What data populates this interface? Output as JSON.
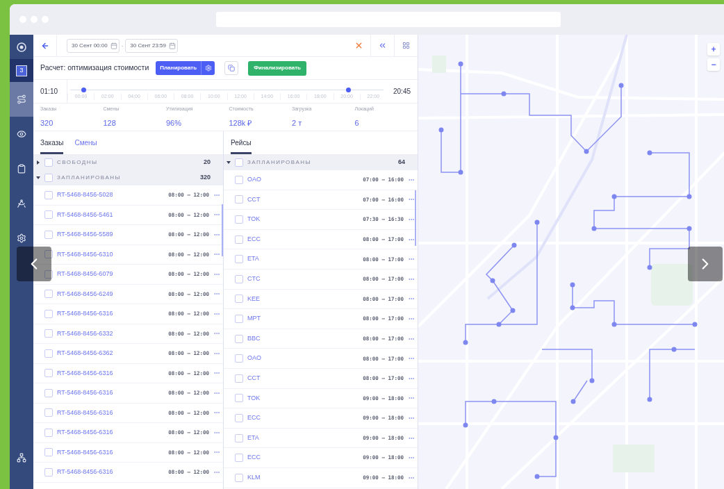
{
  "sidebar": {
    "badge": "3",
    "items": [
      {
        "selected": true
      },
      {
        "selected": false
      },
      {
        "selected": false
      },
      {
        "selected": false
      },
      {
        "selected": false
      }
    ]
  },
  "toolbar": {
    "date_from": "30 Сент 00:00",
    "separator": "-",
    "date_to": "30 Сент 23:59"
  },
  "calc": {
    "title": "Расчет: оптимизация стоимости",
    "plan_button": "Планировать",
    "finalize_button": "Финализировать"
  },
  "timeline": {
    "start": "01:10",
    "end": "20:45",
    "ticks": [
      "00:00",
      "02:00",
      "04:00",
      "06:00",
      "08:00",
      "10:00",
      "12:00",
      "14:00",
      "16:00",
      "18:00",
      "20:00",
      "22:00"
    ],
    "thumbs": [
      {
        "level": 0.05
      },
      {
        "level": 0.88
      }
    ]
  },
  "stats": [
    {
      "label": "Заказы",
      "value": "320"
    },
    {
      "label": "Смены",
      "value": "128"
    },
    {
      "label": "Утилизация",
      "value": "96%"
    },
    {
      "label": "Стоимость",
      "value": "128k ₽"
    },
    {
      "label": "Загрузка",
      "value": "2 т"
    },
    {
      "label": "Локаций",
      "value": "6"
    }
  ],
  "orders_panel": {
    "tabs": [
      {
        "label": "Заказы",
        "selected": true
      },
      {
        "label": "Смены",
        "selected": false
      }
    ],
    "groups": [
      {
        "label": "СВОБОДНЫ",
        "count": "20",
        "expanded": false,
        "checked": false
      },
      {
        "label": "ЗАПЛАНИРОВАНЫ",
        "count": "320",
        "expanded": true,
        "checked": false
      }
    ],
    "rows": [
      {
        "id": "RT-5468-8456-5028",
        "time": "08:00 — 12:00",
        "checked": false
      },
      {
        "id": "RT-5468-8456-5461",
        "time": "08:00 — 12:00",
        "checked": false
      },
      {
        "id": "RT-5468-8456-5589",
        "time": "08:00 — 12:00",
        "checked": false
      },
      {
        "id": "RT-5468-8456-6310",
        "time": "08:00 — 12:00",
        "checked": false
      },
      {
        "id": "RT-5468-8456-6079",
        "time": "08:00 — 12:00",
        "checked": false
      },
      {
        "id": "RT-5468-8456-6249",
        "time": "08:00 — 12:00",
        "checked": false
      },
      {
        "id": "RT-5468-8456-6316",
        "time": "08:00 — 12:00",
        "checked": false
      },
      {
        "id": "RT-5468-8456-6332",
        "time": "08:00 — 12:00",
        "checked": false
      },
      {
        "id": "RT-5468-8456-6362",
        "time": "08:00 — 12:00",
        "checked": false
      },
      {
        "id": "RT-5468-8456-6316",
        "time": "08:00 — 12:00",
        "checked": false
      },
      {
        "id": "RT-5468-8456-6316",
        "time": "08:00 — 12:00",
        "checked": false
      },
      {
        "id": "RT-5468-8456-6316",
        "time": "08:00 — 12:00",
        "checked": false
      },
      {
        "id": "RT-5468-8456-6316",
        "time": "08:00 — 12:00",
        "checked": false
      },
      {
        "id": "RT-5468-8456-6316",
        "time": "08:00 — 12:00",
        "checked": false
      },
      {
        "id": "RT-5468-8456-6316",
        "time": "08:00 — 12:00",
        "checked": false
      }
    ]
  },
  "trips_panel": {
    "tabs": [
      {
        "label": "Рейсы",
        "selected": true
      }
    ],
    "groups": [
      {
        "label": "ЗАПЛАНИРОВАНЫ",
        "count": "64",
        "expanded": true,
        "checked": false
      }
    ],
    "rows": [
      {
        "id": "OAO",
        "time": "07:00 — 16:00",
        "checked": false
      },
      {
        "id": "CCT",
        "time": "07:00 — 16:00",
        "checked": false
      },
      {
        "id": "TOK",
        "time": "07:30 — 16:30",
        "checked": false
      },
      {
        "id": "ECC",
        "time": "08:00 — 17:00",
        "checked": false
      },
      {
        "id": "ETA",
        "time": "08:00 — 17:00",
        "checked": false
      },
      {
        "id": "CTC",
        "time": "08:00 — 17:00",
        "checked": false
      },
      {
        "id": "KEE",
        "time": "08:00 — 17:00",
        "checked": false
      },
      {
        "id": "MPT",
        "time": "08:00 — 17:00",
        "checked": false
      },
      {
        "id": "BBC",
        "time": "08:00 — 17:00",
        "checked": false
      },
      {
        "id": "OAO",
        "time": "08:00 — 17:00",
        "checked": false
      },
      {
        "id": "CCT",
        "time": "08:00 — 17:00",
        "checked": false
      },
      {
        "id": "TOK",
        "time": "09:00 — 18:00",
        "checked": false
      },
      {
        "id": "ECC",
        "time": "09:00 — 18:00",
        "checked": false
      },
      {
        "id": "ETA",
        "time": "09:00 — 18:00",
        "checked": false
      },
      {
        "id": "ECC",
        "time": "09:00 — 18:00",
        "checked": false
      },
      {
        "id": "KLM",
        "time": "09:00 — 18:00",
        "checked": false
      }
    ]
  },
  "map": {
    "zoom_in": "+",
    "zoom_out": "−"
  }
}
